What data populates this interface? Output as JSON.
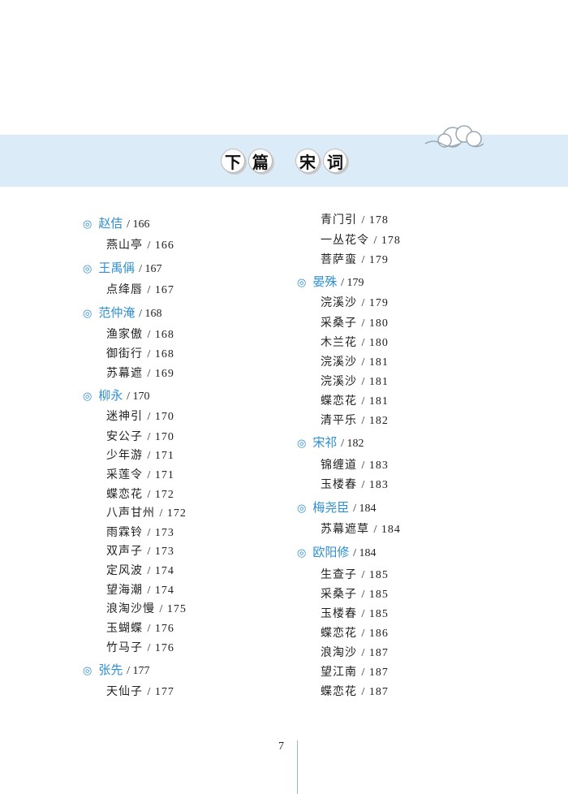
{
  "banner": {
    "title_words": [
      [
        "下",
        "篇"
      ],
      [
        "宋",
        "词"
      ]
    ]
  },
  "left_column": [
    {
      "type": "author",
      "name": "赵佶",
      "page": "/ 166"
    },
    {
      "type": "poem",
      "title": "燕山亭",
      "page": "/ 166"
    },
    {
      "type": "author",
      "name": "王禹偁",
      "page": "/ 167"
    },
    {
      "type": "poem",
      "title": "点绛唇",
      "page": "/ 167"
    },
    {
      "type": "author",
      "name": "范仲淹",
      "page": "/ 168"
    },
    {
      "type": "poem",
      "title": "渔家傲",
      "page": "/ 168"
    },
    {
      "type": "poem",
      "title": "御街行",
      "page": "/ 168"
    },
    {
      "type": "poem",
      "title": "苏幕遮",
      "page": "/ 169"
    },
    {
      "type": "author",
      "name": "柳永",
      "page": "/ 170"
    },
    {
      "type": "poem",
      "title": "迷神引",
      "page": "/ 170"
    },
    {
      "type": "poem",
      "title": "安公子",
      "page": "/ 170"
    },
    {
      "type": "poem",
      "title": "少年游",
      "page": "/ 171"
    },
    {
      "type": "poem",
      "title": "采莲令",
      "page": "/ 171"
    },
    {
      "type": "poem",
      "title": "蝶恋花",
      "page": "/ 172"
    },
    {
      "type": "poem",
      "title": "八声甘州",
      "page": "/ 172"
    },
    {
      "type": "poem",
      "title": "雨霖铃",
      "page": "/ 173"
    },
    {
      "type": "poem",
      "title": "双声子",
      "page": "/ 173"
    },
    {
      "type": "poem",
      "title": "定风波",
      "page": "/ 174"
    },
    {
      "type": "poem",
      "title": "望海潮",
      "page": "/ 174"
    },
    {
      "type": "poem",
      "title": "浪淘沙慢",
      "page": "/ 175"
    },
    {
      "type": "poem",
      "title": "玉蝴蝶",
      "page": "/ 176"
    },
    {
      "type": "poem",
      "title": "竹马子",
      "page": "/ 176"
    },
    {
      "type": "author",
      "name": "张先",
      "page": "/ 177"
    },
    {
      "type": "poem",
      "title": "天仙子",
      "page": "/ 177"
    }
  ],
  "right_column": [
    {
      "type": "poem",
      "title": "青门引",
      "page": "/ 178"
    },
    {
      "type": "poem",
      "title": "一丛花令",
      "page": "/ 178"
    },
    {
      "type": "poem",
      "title": "菩萨蛮",
      "page": "/ 179"
    },
    {
      "type": "author",
      "name": "晏殊",
      "page": "/ 179"
    },
    {
      "type": "poem",
      "title": "浣溪沙",
      "page": "/ 179"
    },
    {
      "type": "poem",
      "title": "采桑子",
      "page": "/ 180"
    },
    {
      "type": "poem",
      "title": "木兰花",
      "page": "/ 180"
    },
    {
      "type": "poem",
      "title": "浣溪沙",
      "page": "/ 181"
    },
    {
      "type": "poem",
      "title": "浣溪沙",
      "page": "/ 181"
    },
    {
      "type": "poem",
      "title": "蝶恋花",
      "page": "/ 181"
    },
    {
      "type": "poem",
      "title": "清平乐",
      "page": "/ 182"
    },
    {
      "type": "author",
      "name": "宋祁",
      "page": "/ 182"
    },
    {
      "type": "poem",
      "title": "锦缠道",
      "page": "/ 183"
    },
    {
      "type": "poem",
      "title": "玉楼春",
      "page": "/ 183"
    },
    {
      "type": "author",
      "name": "梅尧臣",
      "page": "/ 184"
    },
    {
      "type": "poem",
      "title": "苏幕遮草",
      "page": "/ 184"
    },
    {
      "type": "author",
      "name": "欧阳修",
      "page": "/ 184"
    },
    {
      "type": "poem",
      "title": "生查子",
      "page": "/ 185"
    },
    {
      "type": "poem",
      "title": "采桑子",
      "page": "/ 185"
    },
    {
      "type": "poem",
      "title": "玉楼春",
      "page": "/ 185"
    },
    {
      "type": "poem",
      "title": "蝶恋花",
      "page": "/ 186"
    },
    {
      "type": "poem",
      "title": "浪淘沙",
      "page": "/ 187"
    },
    {
      "type": "poem",
      "title": "望江南",
      "page": "/ 187"
    },
    {
      "type": "poem",
      "title": "蝶恋花",
      "page": "/ 187"
    }
  ],
  "author_marker": "◎",
  "page_number": "7",
  "colors": {
    "accent": "#2f8fd0",
    "banner": "#dcebf8"
  }
}
